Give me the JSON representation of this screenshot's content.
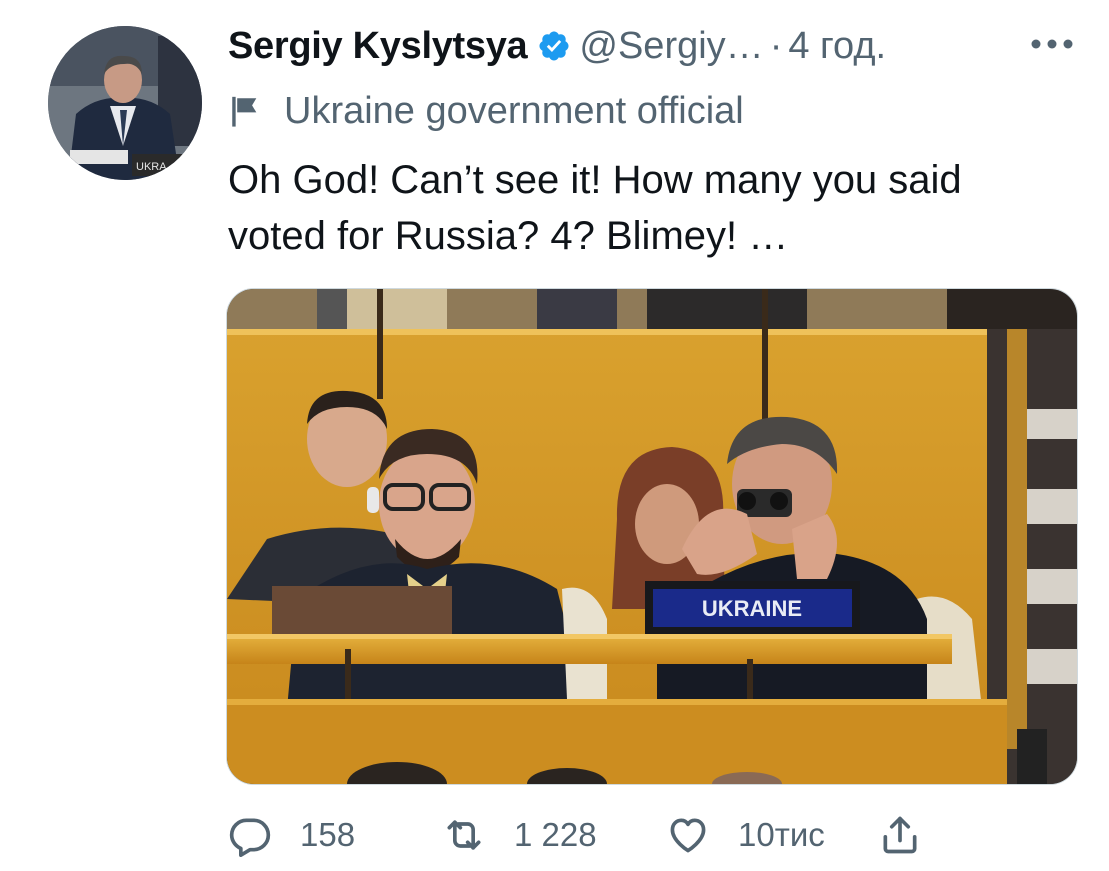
{
  "tweet": {
    "author_name": "Sergiy Kyslytsya",
    "handle": "@Sergiy…",
    "separator": "·",
    "time": "4 год.",
    "label": "Ukraine government official",
    "text_line1": "Oh God! Can’t see it! How many you said",
    "text_line2": "voted for Russia? 4? Blimey! …",
    "avatar_nameplate": "UKRA",
    "media": {
      "sign_text": "UKRAINE"
    }
  },
  "actions": {
    "replies": "158",
    "retweets": "1 228",
    "likes": "10тис"
  },
  "colors": {
    "verified": "#1d9bf0",
    "secondary_text": "#536471",
    "primary_text": "#0f1419"
  },
  "icons": {
    "more": "more-dots-icon",
    "verified": "verified-badge-icon",
    "label": "flag-icon",
    "reply": "reply-icon",
    "retweet": "retweet-icon",
    "like": "heart-icon",
    "share": "share-icon"
  }
}
